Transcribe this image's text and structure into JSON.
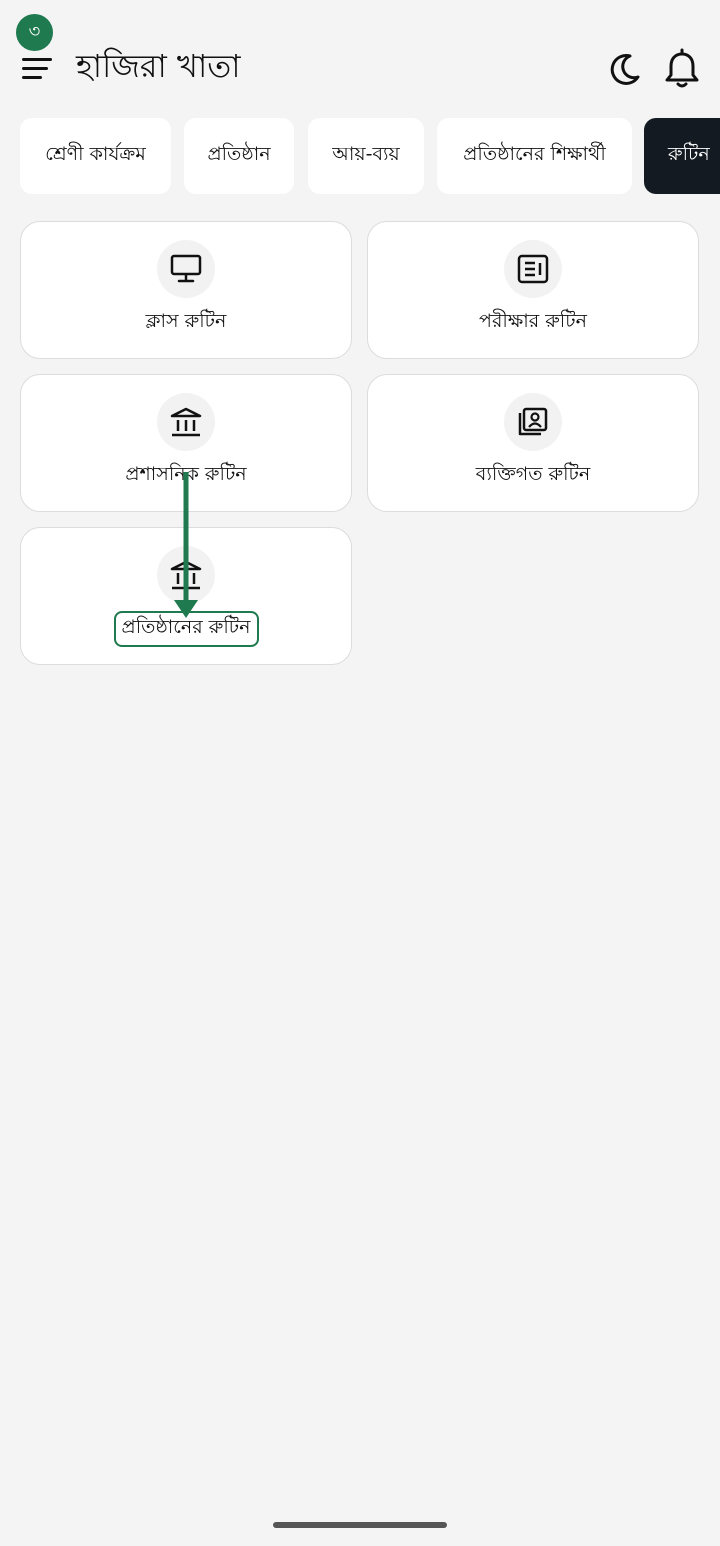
{
  "annotation": {
    "step_badge": "৩",
    "accent_color": "#1f7a4f"
  },
  "header": {
    "title": "হাজিরা খাতা",
    "menu_icon": "hamburger-menu-icon",
    "theme_icon": "moon-icon",
    "notification_icon": "bell-icon"
  },
  "tabs": [
    {
      "label": "শ্রেণী কার্যক্রম",
      "active": false
    },
    {
      "label": "প্রতিষ্ঠান",
      "active": false
    },
    {
      "label": "আয়-ব্যয়",
      "active": false
    },
    {
      "label": "প্রতিষ্ঠানের শিক্ষার্থী",
      "active": false
    },
    {
      "label": "রুটিন",
      "active": true
    }
  ],
  "cards": [
    {
      "label": "ক্লাস রুটিন",
      "icon": "monitor-icon"
    },
    {
      "label": "পরীক্ষার রুটিন",
      "icon": "newspaper-icon"
    },
    {
      "label": "প্রশাসনিক রুটিন",
      "icon": "institution-icon"
    },
    {
      "label": "ব্যক্তিগত রুটিন",
      "icon": "contact-card-icon"
    },
    {
      "label": "প্রতিষ্ঠানের রুটিন",
      "icon": "institution-icon"
    }
  ]
}
